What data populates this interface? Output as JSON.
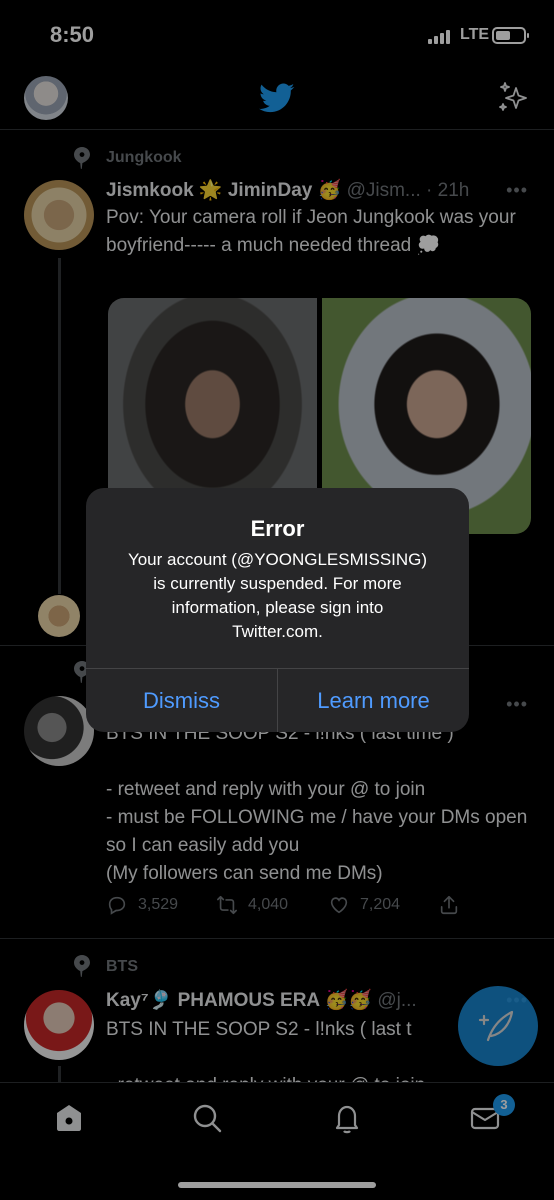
{
  "status_bar": {
    "time": "8:50",
    "network": "LTE"
  },
  "top_bar": {
    "logo": "twitter-bird-icon"
  },
  "tweets": [
    {
      "context": "Jungkook",
      "name": "Jismkook 🌟 JiminDay 🥳",
      "handle": "@Jism...",
      "time": "· 21h",
      "more": "•••",
      "text": "Pov: Your camera roll if Jeon Jungkook was your boyfriend----- a much needed thread 💭"
    },
    {
      "more": "•••",
      "text_first": "BTS IN THE SOOP S2  -   l!nks ( last time )",
      "text": "- retweet and reply with your @ to join\n- must be FOLLOWING me / have your DMs open so I can easily add you\n(My followers can send me DMs)",
      "replies": "3,529",
      "retweets": "4,040",
      "likes": "7,204"
    },
    {
      "context": "BTS",
      "name": "Kay⁷🎐 PHAMOUS ERA 🥳🥳",
      "handle": "@j...",
      "more": "•••",
      "text": "BTS IN THE SOOP S2  -   l!nks ( last t",
      "text_cut": "- retweet and reply with your @ to join"
    }
  ],
  "tab_bar": {
    "notifications_badge": "3"
  },
  "alert": {
    "title": "Error",
    "message": "Your account (@YOONGLESMISSING)\nis currently suspended. For more\ninformation, please sign into\nTwitter.com.",
    "dismiss": "Dismiss",
    "learn_more": "Learn more"
  },
  "colors": {
    "accent": "#1d9bf0",
    "alert_button": "#4f9bff",
    "muted": "#71767b"
  }
}
